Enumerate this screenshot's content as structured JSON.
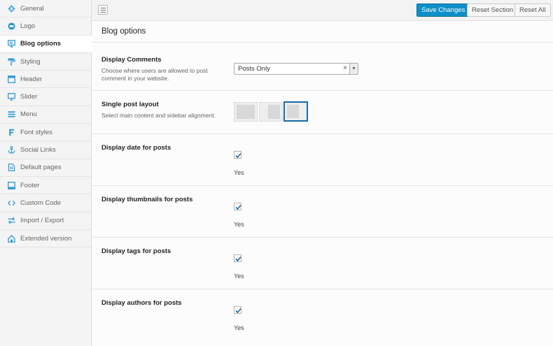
{
  "sidebar": {
    "items": [
      {
        "label": "General",
        "icon": "gear-icon"
      },
      {
        "label": "Logo",
        "icon": "logo-icon"
      },
      {
        "label": "Blog options",
        "icon": "monitor-icon",
        "active": true
      },
      {
        "label": "Styling",
        "icon": "paint-roller-icon"
      },
      {
        "label": "Header",
        "icon": "header-icon"
      },
      {
        "label": "Slider",
        "icon": "slider-icon"
      },
      {
        "label": "Menu",
        "icon": "menu-icon"
      },
      {
        "label": "Font styles",
        "icon": "font-icon"
      },
      {
        "label": "Social Links",
        "icon": "anchor-icon"
      },
      {
        "label": "Default pages",
        "icon": "pages-icon"
      },
      {
        "label": "Footer",
        "icon": "footer-icon"
      },
      {
        "label": "Custom Code",
        "icon": "code-icon"
      },
      {
        "label": "Import / Export",
        "icon": "import-export-icon"
      },
      {
        "label": "Extended version",
        "icon": "home-icon"
      }
    ]
  },
  "toolbar": {
    "save_label": "Save Changes",
    "reset_section_label": "Reset Section",
    "reset_all_label": "Reset All"
  },
  "main": {
    "section_title": "Blog options",
    "display_comments": {
      "label": "Display Comments",
      "description": "Choose where users are allowed to post comment in your website.",
      "value": "Posts Only",
      "clear_glyph": "×",
      "arrow_glyph": "▼"
    },
    "single_post_layout": {
      "label": "Single post layout",
      "description": "Select main content and sidebar alignment.",
      "selected_index": 2
    },
    "checkbox_rows": [
      {
        "label": "Display date for posts",
        "checked": true,
        "value_text": "Yes"
      },
      {
        "label": "Display thumbnails for posts",
        "checked": true,
        "value_text": "Yes"
      },
      {
        "label": "Display tags for posts",
        "checked": true,
        "value_text": "Yes"
      },
      {
        "label": "Display authors for posts",
        "checked": true,
        "value_text": "Yes"
      }
    ]
  },
  "colors": {
    "accent": "#0e8fc7",
    "icon": "#2a9ad6",
    "selected_border": "#1a6aa6"
  }
}
